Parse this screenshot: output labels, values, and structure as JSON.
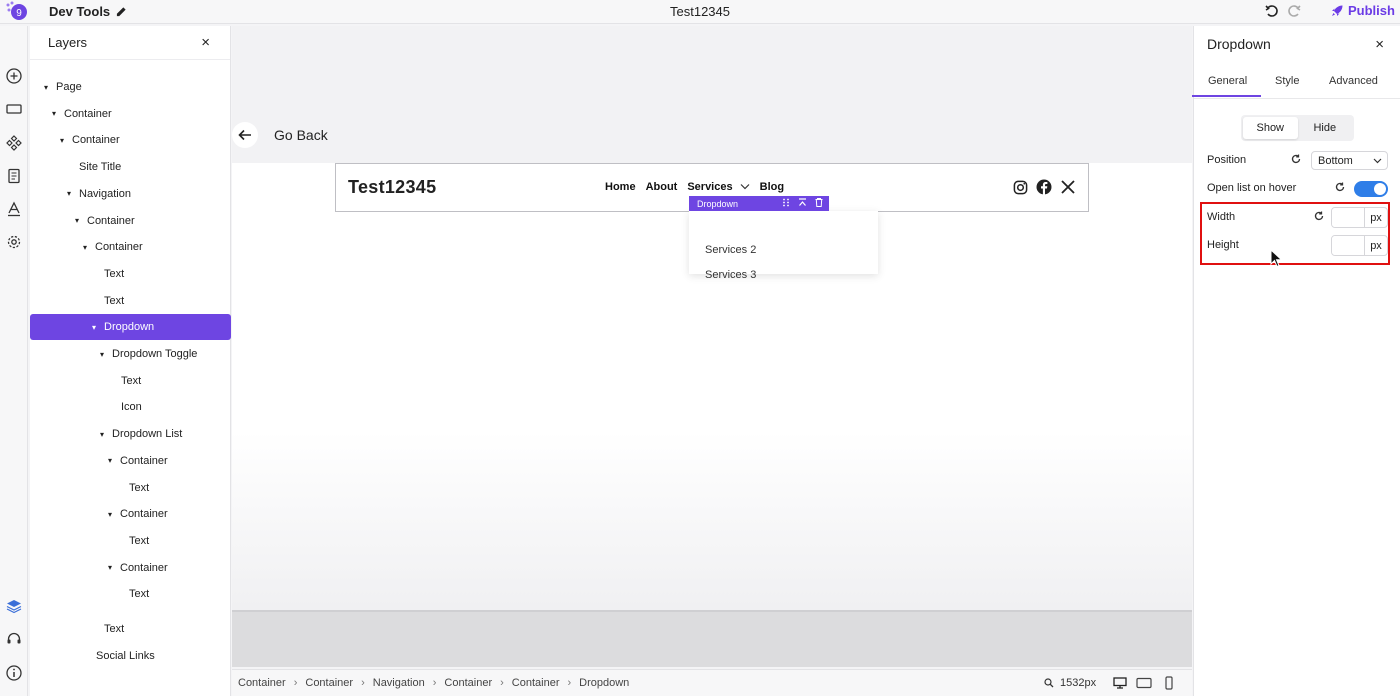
{
  "app": {
    "title": "Dev Tools",
    "document_title": "Test12345",
    "publish_label": "Publish"
  },
  "layers": {
    "title": "Layers",
    "close": "×",
    "nodes": [
      {
        "label": "Page",
        "caret": true
      },
      {
        "label": "Container",
        "caret": true
      },
      {
        "label": "Container",
        "caret": true
      },
      {
        "label": "Site Title",
        "caret": false
      },
      {
        "label": "Navigation",
        "caret": true
      },
      {
        "label": "Container",
        "caret": true
      },
      {
        "label": "Container",
        "caret": true
      },
      {
        "label": "Text",
        "caret": false
      },
      {
        "label": "Text",
        "caret": false
      },
      {
        "label": "Dropdown",
        "caret": true,
        "selected": true
      },
      {
        "label": "Dropdown Toggle",
        "caret": true
      },
      {
        "label": "Text",
        "caret": false
      },
      {
        "label": "Icon",
        "caret": false
      },
      {
        "label": "Dropdown List",
        "caret": true
      },
      {
        "label": "Container",
        "caret": true
      },
      {
        "label": "Text",
        "caret": false
      },
      {
        "label": "Container",
        "caret": true
      },
      {
        "label": "Text",
        "caret": false
      },
      {
        "label": "Container",
        "caret": true
      },
      {
        "label": "Text",
        "caret": false
      },
      {
        "label": "Text",
        "caret": false
      },
      {
        "label": "Social Links",
        "caret": false
      }
    ]
  },
  "canvas": {
    "go_back": "Go Back",
    "site_title": "Test12345",
    "menu": {
      "home": "Home",
      "about": "About",
      "services": "Services",
      "blog": "Blog"
    },
    "dropdown_tag": "Dropdown",
    "dropdown_items": [
      "Services 2",
      "Services 3"
    ]
  },
  "breadcrumb": {
    "items": [
      "Container",
      "Container",
      "Navigation",
      "Container",
      "Container",
      "Dropdown"
    ],
    "zoom": "1532px"
  },
  "inspector": {
    "title": "Dropdown",
    "close": "×",
    "tabs": {
      "general": "General",
      "style": "Style",
      "advanced": "Advanced"
    },
    "visibility": {
      "show": "Show",
      "hide": "Hide"
    },
    "position_label": "Position",
    "position_value": "Bottom",
    "hover_label": "Open list on hover",
    "width_label": "Width",
    "height_label": "Height",
    "unit": "px"
  },
  "colors": {
    "accent": "#6e45e2",
    "toggle": "#2f7ee8",
    "highlight": "#e01010"
  }
}
